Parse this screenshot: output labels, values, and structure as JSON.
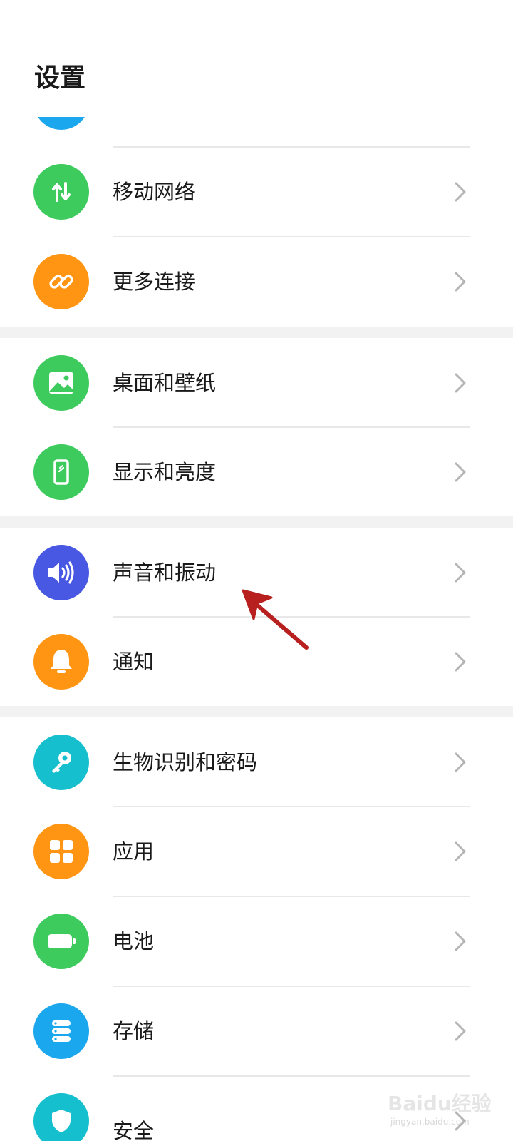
{
  "page": {
    "title": "设置"
  },
  "colors": {
    "accent_blue": "#1aa7ee",
    "green": "#3ecb5d",
    "orange": "#ff9512",
    "indigo": "#4858e2",
    "teal": "#16bfce",
    "annotation_red": "#b82020"
  },
  "groups": [
    {
      "items": [
        {
          "label": "",
          "icon": "partial-edit-icon",
          "color": "#1aa7ee"
        },
        {
          "label": "移动网络",
          "icon": "mobile-data-arrows-icon",
          "color": "#3ecb5d"
        },
        {
          "label": "更多连接",
          "icon": "link-icon",
          "color": "#ff9512"
        }
      ]
    },
    {
      "items": [
        {
          "label": "桌面和壁纸",
          "icon": "wallpaper-icon",
          "color": "#3ecb5d"
        },
        {
          "label": "显示和亮度",
          "icon": "display-phone-icon",
          "color": "#3ecb5d"
        }
      ]
    },
    {
      "items": [
        {
          "label": "声音和振动",
          "icon": "speaker-icon",
          "color": "#4858e2"
        },
        {
          "label": "通知",
          "icon": "bell-icon",
          "color": "#ff9512"
        }
      ]
    },
    {
      "items": [
        {
          "label": "生物识别和密码",
          "icon": "key-icon",
          "color": "#16bfce"
        },
        {
          "label": "应用",
          "icon": "apps-grid-icon",
          "color": "#ff9512"
        },
        {
          "label": "电池",
          "icon": "battery-icon",
          "color": "#3ecb5d"
        },
        {
          "label": "存储",
          "icon": "storage-icon",
          "color": "#1aa7ee"
        },
        {
          "label": "安全",
          "icon": "shield-icon",
          "color": "#16bfce"
        }
      ]
    }
  ],
  "annotation": {
    "icon": "red-arrow-icon"
  },
  "watermark": {
    "logo": "Baidu经验",
    "sub": "jingyan.baidu.com"
  }
}
